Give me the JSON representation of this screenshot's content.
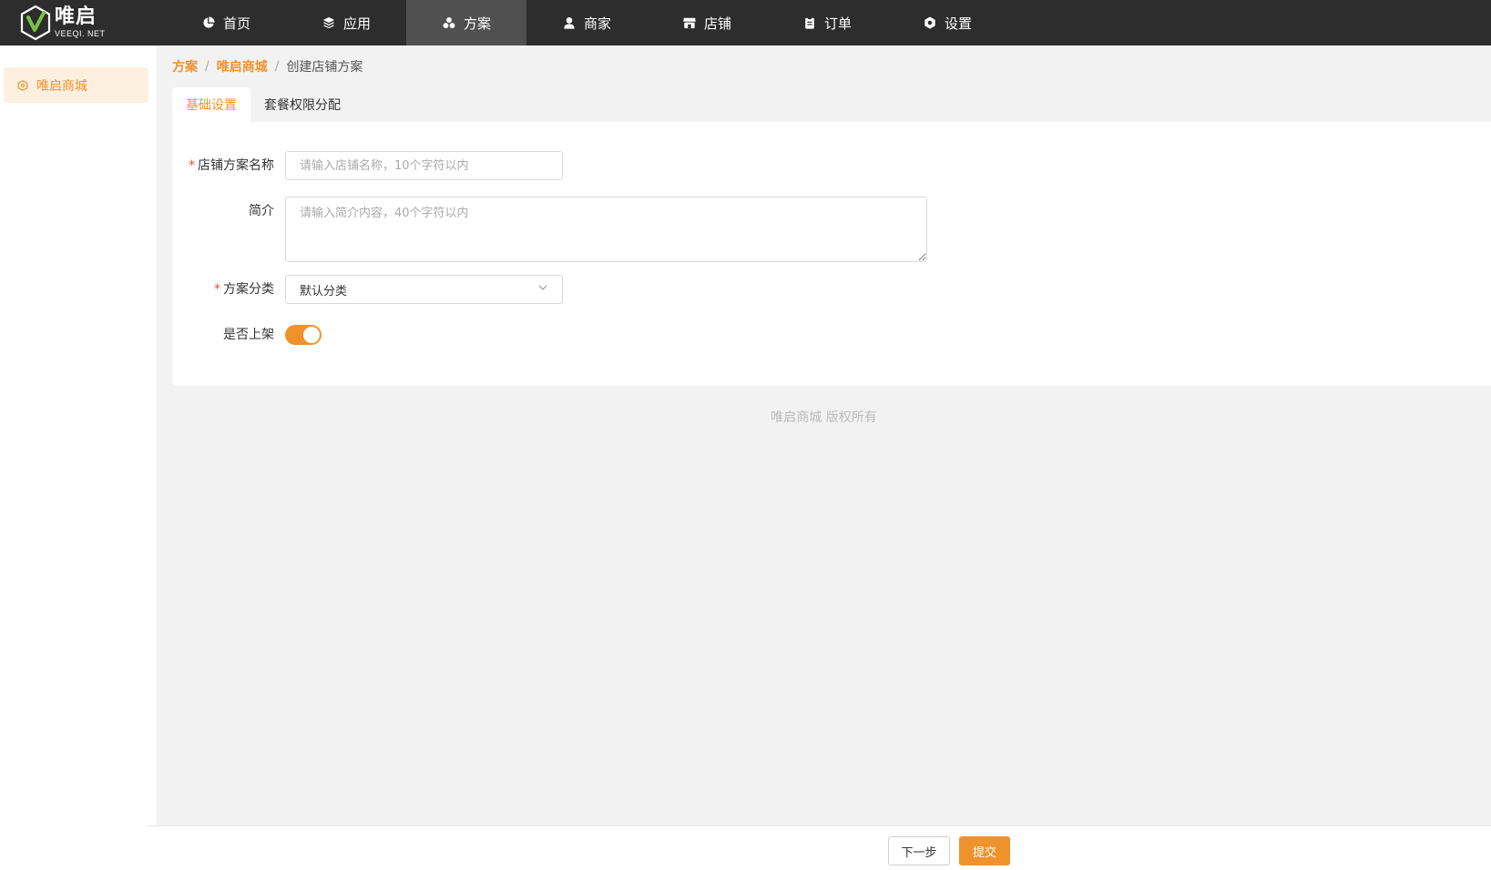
{
  "brand": {
    "name_cn": "唯启",
    "name_en": "VEEQI. NET"
  },
  "nav": {
    "items": [
      {
        "label": "首页",
        "icon": "pie-chart-icon"
      },
      {
        "label": "应用",
        "icon": "layers-icon"
      },
      {
        "label": "方案",
        "icon": "cluster-icon",
        "active": true
      },
      {
        "label": "商家",
        "icon": "user-icon"
      },
      {
        "label": "店铺",
        "icon": "store-icon"
      },
      {
        "label": "订单",
        "icon": "clipboard-icon"
      },
      {
        "label": "设置",
        "icon": "gear-icon"
      }
    ]
  },
  "sidebar": {
    "items": [
      {
        "label": "唯启商城",
        "icon": "hexagon-icon",
        "active": true
      }
    ]
  },
  "breadcrumb": {
    "items": [
      "方案",
      "唯启商城"
    ],
    "current": "创建店铺方案",
    "separator": "/"
  },
  "tabs": [
    {
      "label": "基础设置",
      "active": true
    },
    {
      "label": "套餐权限分配"
    }
  ],
  "form": {
    "name": {
      "label": "店铺方案名称",
      "required": true,
      "value": "",
      "placeholder": "请输入店铺名称，10个字符以内"
    },
    "intro": {
      "label": "简介",
      "value": "",
      "placeholder": "请输入简介内容，40个字符以内"
    },
    "category": {
      "label": "方案分类",
      "required": true,
      "value": "默认分类"
    },
    "published": {
      "label": "是否上架",
      "value": true
    }
  },
  "footer": {
    "copyright": "唯启商城 版权所有"
  },
  "actions": {
    "next_label": "下一步",
    "submit_label": "提交"
  },
  "colors": {
    "accent": "#f0922b",
    "topbar": "#2d2d2d",
    "nav_active": "#505050",
    "required": "#e74c3c"
  }
}
